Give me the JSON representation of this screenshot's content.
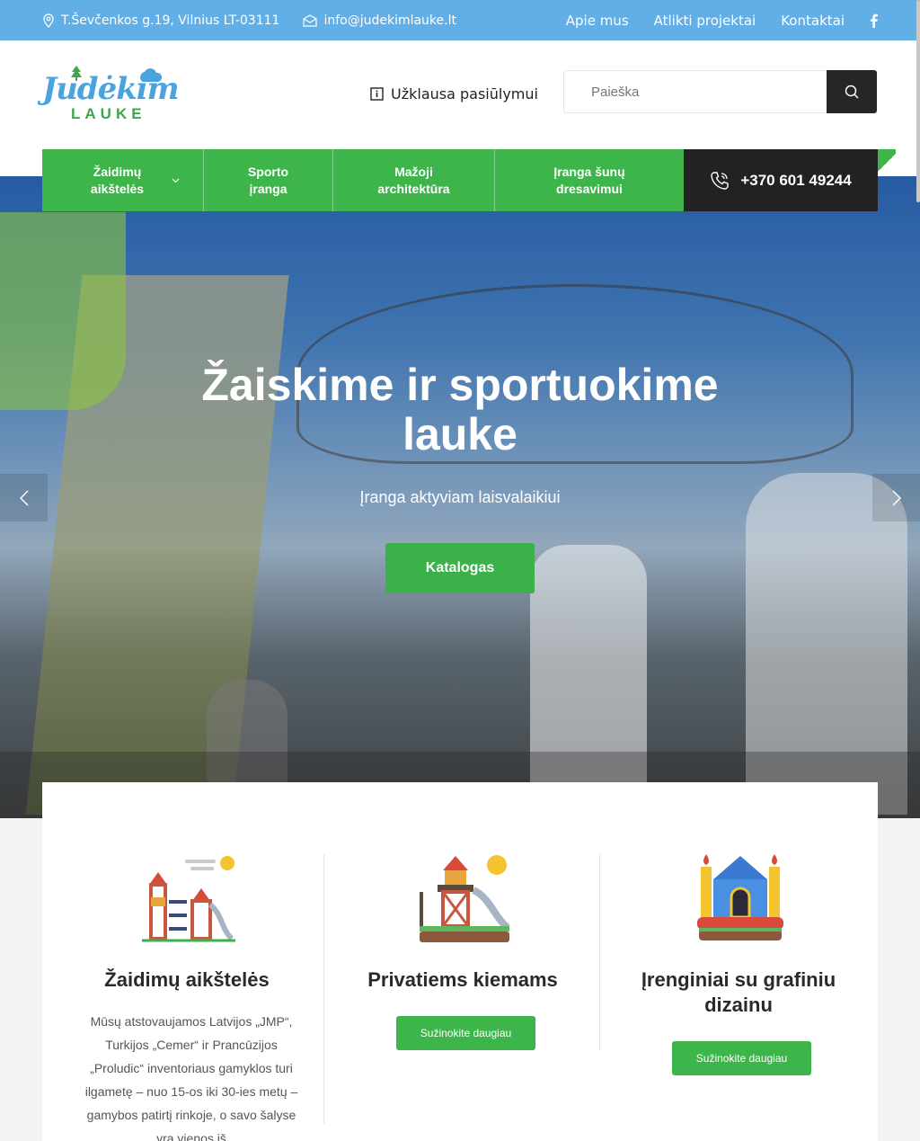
{
  "topbar": {
    "address": "T.Ševčenkos g.19, Vilnius LT-03111",
    "email": "info@judekimlauke.lt",
    "links": [
      "Apie mus",
      "Atlikti projektai",
      "Kontaktai"
    ],
    "social_icon": "facebook-icon"
  },
  "header": {
    "logo_script": "Judėkim",
    "logo_sub": "LAUKE",
    "inquiry_label": "Užklausa pasiūlymui",
    "search_placeholder": "Paieška"
  },
  "nav": {
    "items": [
      {
        "line1": "Žaidimų",
        "line2": "aikštelės"
      },
      {
        "line1": "Sporto",
        "line2": "įranga"
      },
      {
        "line1": "Mažoji",
        "line2": "architektūra"
      },
      {
        "line1": "Įranga šunų",
        "line2": "dresavimui"
      }
    ],
    "phone": "+370 601 49244"
  },
  "hero": {
    "title": "Žaiskime ir sportuokime lauke",
    "subtitle": "Įranga aktyviam laisvalaikiui",
    "cta": "Katalogas"
  },
  "features": [
    {
      "title": "Žaidimų aikštelės",
      "text": "Mūsų atstovaujamos Latvijos „JMP“, Turkijos „Cemer“ ir Prancūzijos „Proludic“ inventoriaus gamyklos turi ilgametę – nuo 15-os iki 30-ies metų – gamybos patirtį rinkoje, o savo šalyse yra vienos iš"
    },
    {
      "title": "Privatiems kiemams",
      "button": "Sužinokite daugiau"
    },
    {
      "title": "Įrenginiai su grafiniu dizainu",
      "button": "Sužinokite daugiau"
    }
  ],
  "colors": {
    "topbar": "#62aee6",
    "accent_green": "#3db54a",
    "dark": "#222222"
  }
}
